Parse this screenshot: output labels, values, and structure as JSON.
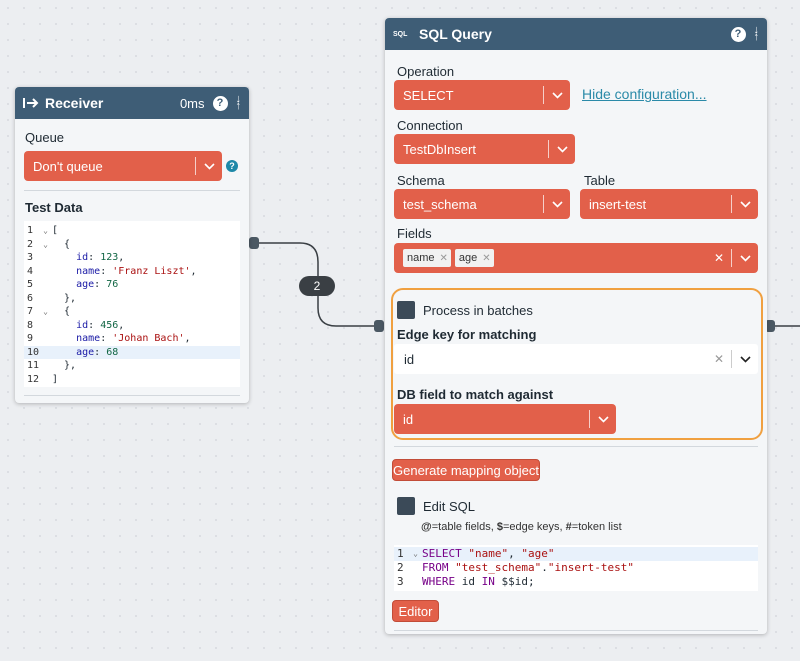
{
  "edge": {
    "label": "2"
  },
  "receiver": {
    "title": "Receiver",
    "timing": "0ms",
    "help": "?",
    "queue_label": "Queue",
    "queue_value": "Don't queue",
    "info": "?",
    "test_data_label": "Test Data",
    "code_lines": [
      {
        "n": "1",
        "fold": true,
        "html": "["
      },
      {
        "n": "2",
        "fold": true,
        "html": "  {"
      },
      {
        "n": "3",
        "fold": false,
        "html": "    <span class='tok-key'>id</span>: <span class='tok-num'>123</span>,"
      },
      {
        "n": "4",
        "fold": false,
        "html": "    <span class='tok-key'>name</span>: <span class='tok-str'>'Franz Liszt'</span>,"
      },
      {
        "n": "5",
        "fold": false,
        "html": "    <span class='tok-key'>age</span>: <span class='tok-num'>76</span>"
      },
      {
        "n": "6",
        "fold": false,
        "html": "  },"
      },
      {
        "n": "7",
        "fold": true,
        "html": "  {"
      },
      {
        "n": "8",
        "fold": false,
        "html": "    <span class='tok-key'>id</span>: <span class='tok-num'>456</span>,"
      },
      {
        "n": "9",
        "fold": false,
        "html": "    <span class='tok-key'>name</span>: <span class='tok-str'>'Johan Bach'</span>,"
      },
      {
        "n": "10",
        "fold": false,
        "hl": true,
        "html": "    <span class='tok-key'>age</span>: <span class='tok-num'>68</span>"
      },
      {
        "n": "11",
        "fold": false,
        "html": "  },"
      },
      {
        "n": "12",
        "fold": false,
        "html": "]"
      }
    ]
  },
  "sql": {
    "title": "SQL Query",
    "icon_text": "SQL",
    "help": "?",
    "operation_label": "Operation",
    "operation_value": "SELECT",
    "hide_config_link": "Hide configuration...",
    "connection_label": "Connection",
    "connection_value": "TestDbInsert",
    "schema_label": "Schema",
    "schema_value": "test_schema",
    "table_label": "Table",
    "table_value": "insert-test",
    "fields_label": "Fields",
    "fields": [
      "name",
      "age"
    ],
    "process_batches_label": "Process in batches",
    "edge_key_label": "Edge key for matching",
    "edge_key_value": "id",
    "db_field_label": "DB field to match against",
    "db_field_value": "id",
    "generate_button": "Generate mapping object",
    "edit_sql_label": "Edit SQL",
    "hint_html": "<b>@</b>=table fields, <b>$</b>=edge keys, <b>#</b>=token list",
    "sql_lines": [
      {
        "n": "1",
        "fold": true,
        "hl": true,
        "html": "<span class='tok-kw'>SELECT</span> <span class='tok-str'>\"name\"</span>, <span class='tok-str'>\"age\"</span>"
      },
      {
        "n": "2",
        "fold": false,
        "html": "<span class='tok-kw'>FROM</span> <span class='tok-str'>\"test_schema\"</span>.<span class='tok-str'>\"insert-test\"</span>"
      },
      {
        "n": "3",
        "fold": false,
        "html": "<span class='tok-kw'>WHERE</span> id <span class='tok-kw'>IN</span> $$id;"
      }
    ],
    "editor_button": "Editor"
  },
  "colors": {
    "header": "#3e5d76",
    "accent": "#e2604a",
    "highlight_border": "#f0a040"
  }
}
